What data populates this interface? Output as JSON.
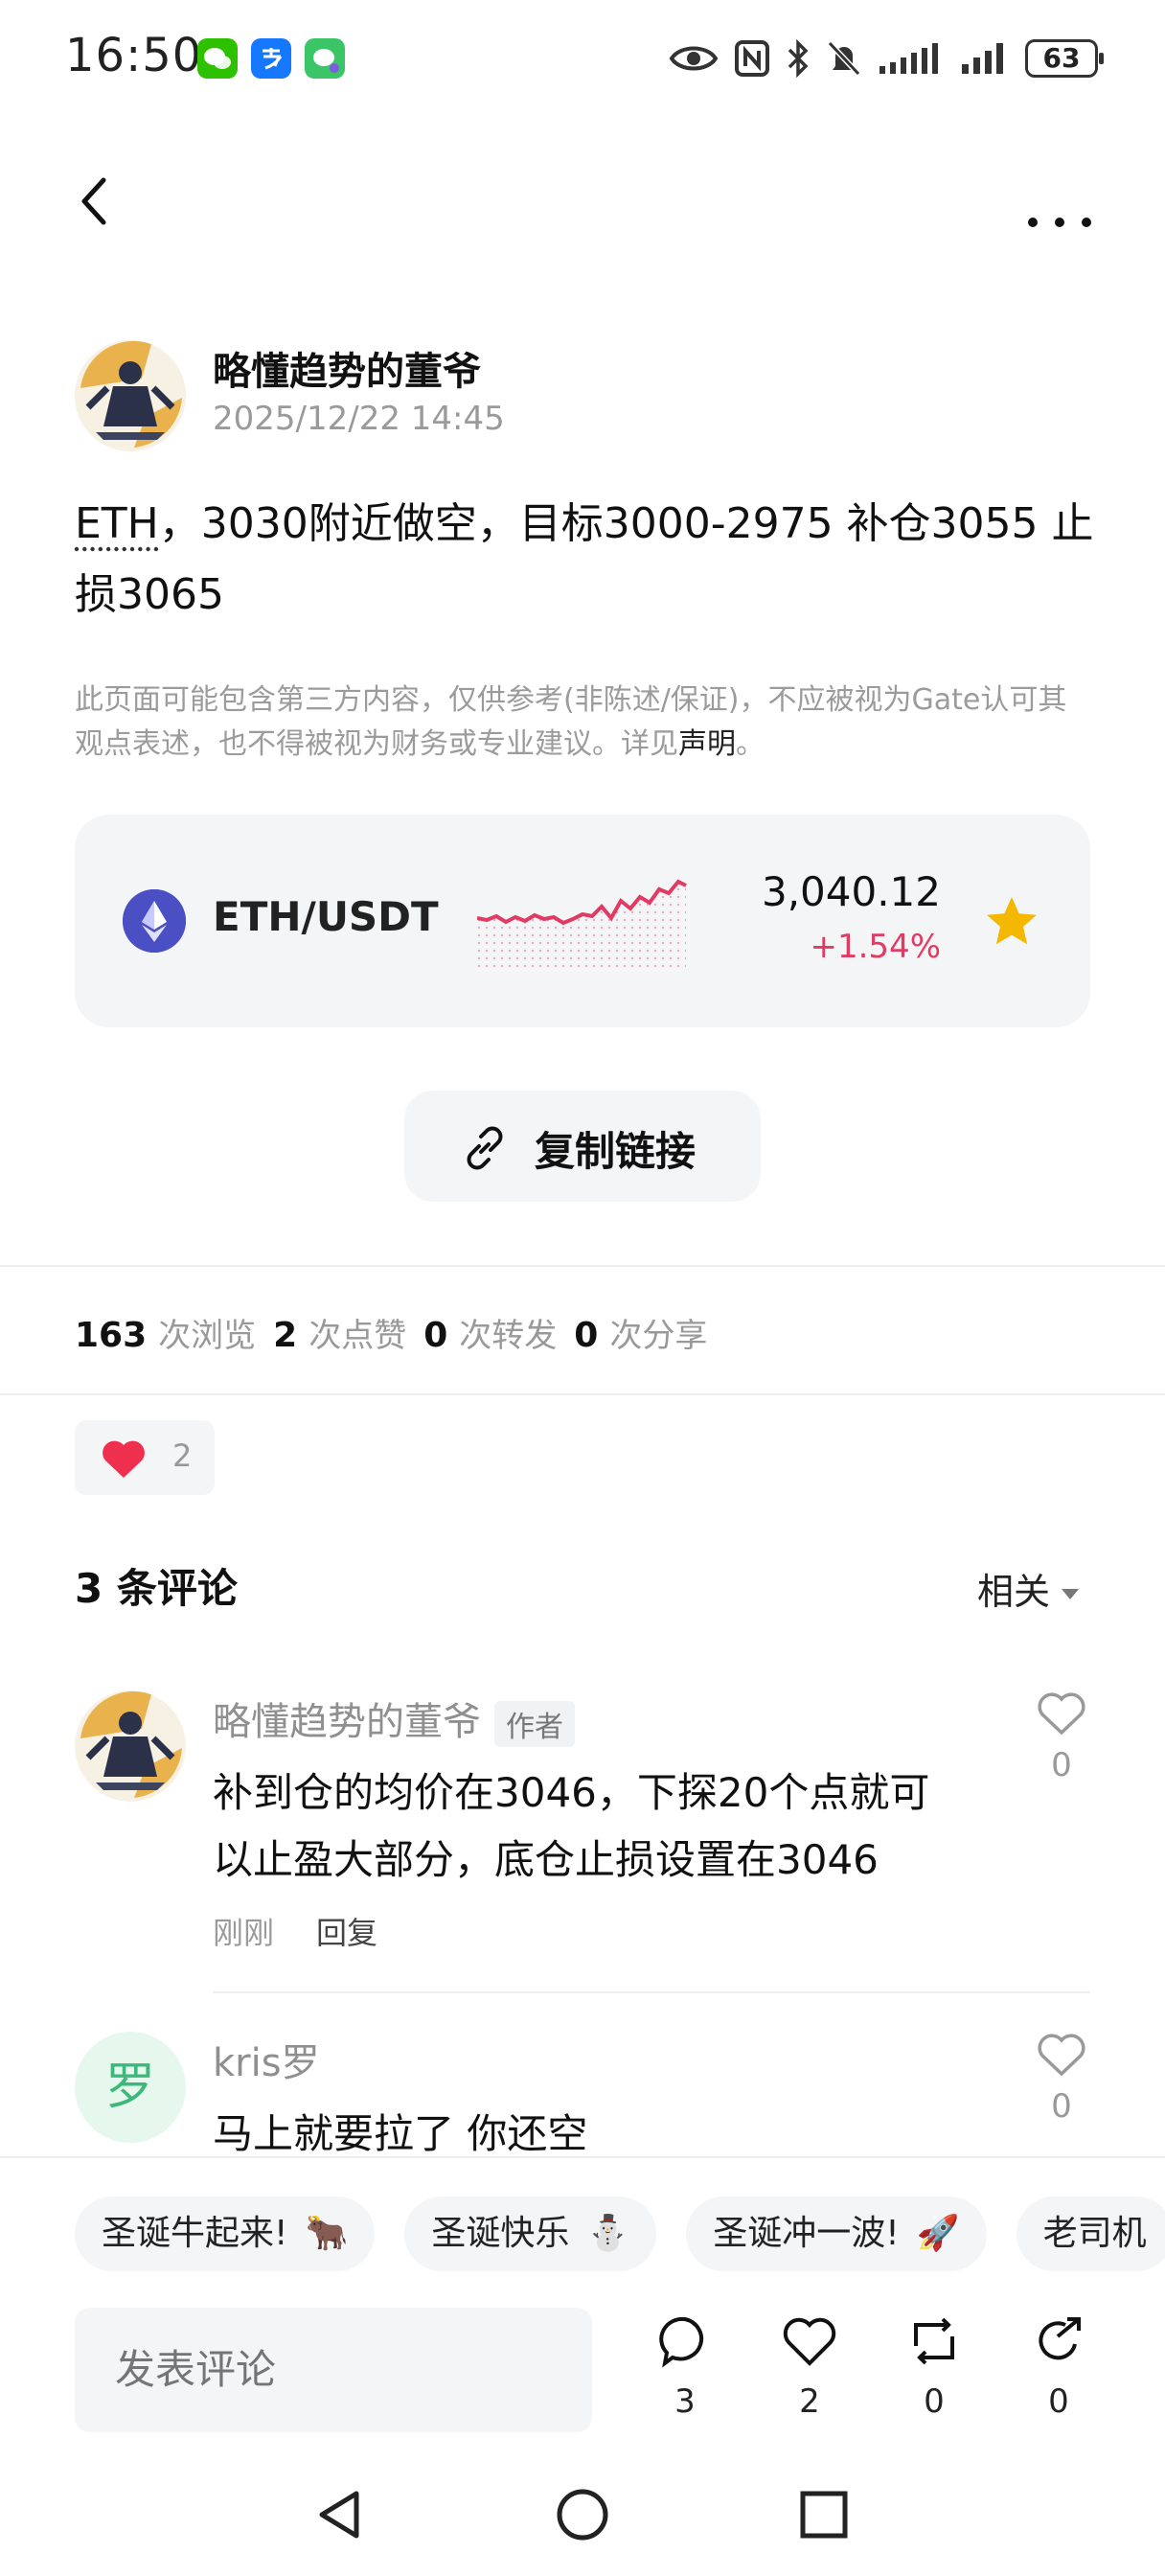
{
  "status_bar": {
    "time": "16:50",
    "battery": "63",
    "app_icons": [
      "wechat-icon",
      "alipay-icon",
      "messages-icon"
    ],
    "indicators": [
      "eye-icon",
      "nfc-icon",
      "bluetooth-icon",
      "bell-off-icon",
      "signal-icon",
      "signal-icon-2"
    ]
  },
  "nav": {
    "back": "back-icon",
    "more": "more-icon"
  },
  "post": {
    "author_name": "略懂趋势的董爷",
    "timestamp": "2025/12/22 14:45",
    "text_tag": "ETH",
    "text_body": "，3030附近做空，目标3000-2975 补仓3055 止损3065",
    "disclaimer": "此页面可能包含第三方内容，仅供参考(非陈述/保证)，不应被视为Gate认可其观点表述，也不得被视为财务或专业建议。详见",
    "disclaimer_link": "声明",
    "disclaimer_end": "。"
  },
  "market": {
    "pair": "ETH/USDT",
    "price": "3,040.12",
    "change": "+1.54%",
    "colors": {
      "up": "#e23b63",
      "star": "#f5b800",
      "eth": "#4a4fc4"
    }
  },
  "copy_button": {
    "label": "复制链接"
  },
  "stats": {
    "views": "163",
    "views_label": "次浏览",
    "likes": "2",
    "likes_label": "次点赞",
    "reposts": "0",
    "reposts_label": "次转发",
    "shares": "0",
    "shares_label": "次分享"
  },
  "reaction": {
    "count": "2"
  },
  "comments": {
    "header": "3 条评论",
    "sort": "相关",
    "items": [
      {
        "name": "略懂趋势的董爷",
        "badge": "作者",
        "text": "补到仓的均价在3046，下探20个点就可以止盈大部分，底仓止损设置在3046",
        "time": "刚刚",
        "reply": "回复",
        "likes": "0"
      },
      {
        "name": "kris罗",
        "avatar_char": "罗",
        "text": "马上就要拉了 你还空",
        "likes": "0"
      }
    ]
  },
  "quick_replies": [
    {
      "label": "圣诞牛起来!",
      "emoji": "🐂"
    },
    {
      "label": "圣诞快乐",
      "emoji": "⛄"
    },
    {
      "label": "圣诞冲一波!",
      "emoji": "🚀"
    },
    {
      "label": "老司机",
      "emoji": ""
    }
  ],
  "bottom_bar": {
    "input_placeholder": "发表评论",
    "comments_count": "3",
    "likes_count": "2",
    "reposts_count": "0",
    "shares_count": "0"
  }
}
